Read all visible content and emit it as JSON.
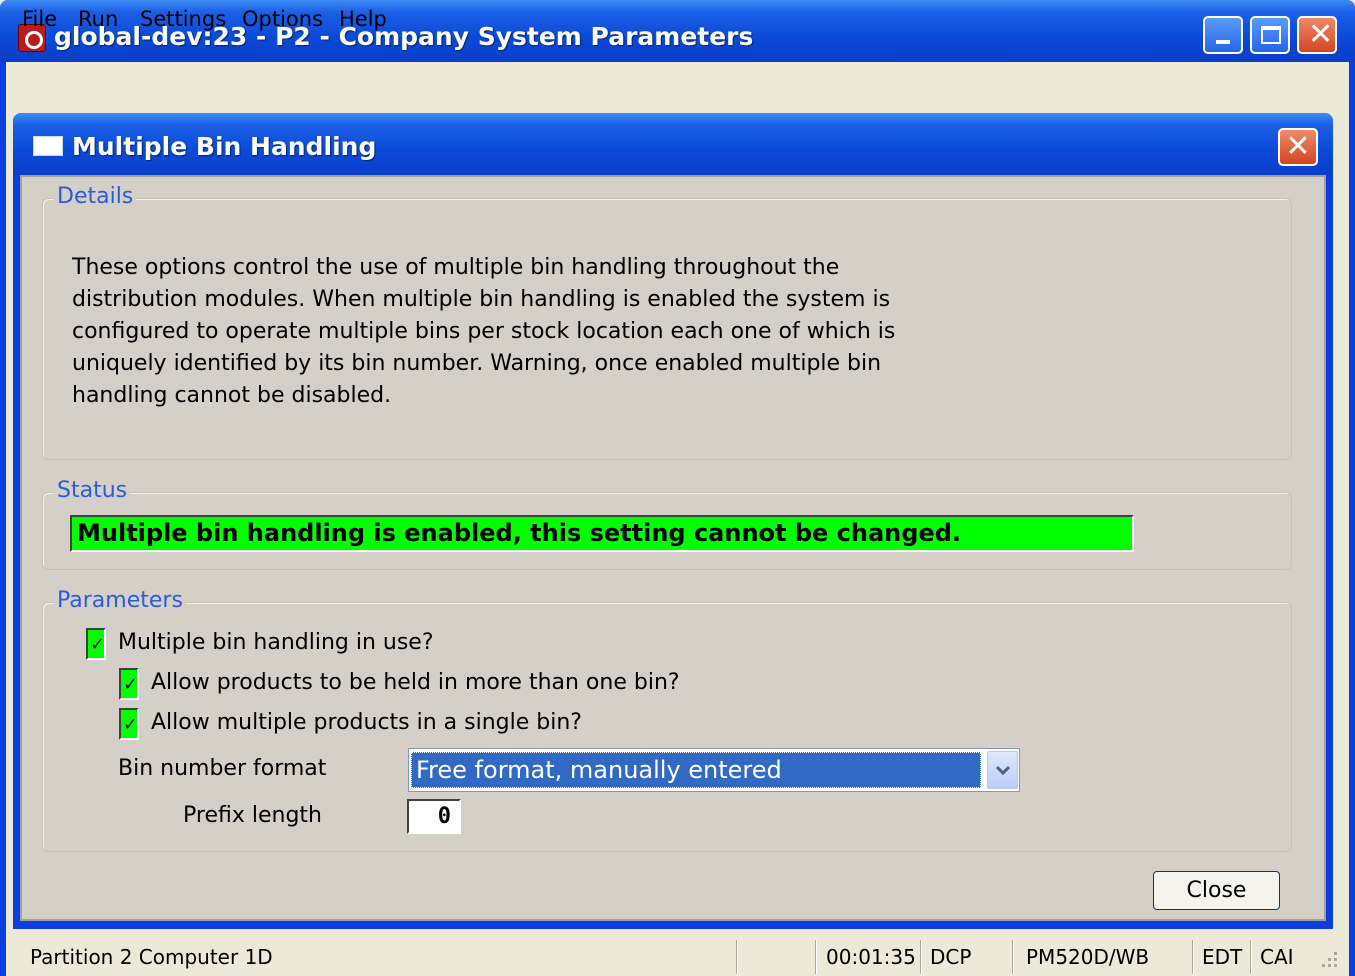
{
  "window": {
    "title": "global-dev:23 - P2 - Company System Parameters"
  },
  "menubar": {
    "items": [
      "File",
      "Run",
      "Settings",
      "Options",
      "Help"
    ]
  },
  "dialog": {
    "title": "Multiple Bin Handling",
    "details": {
      "label": "Details",
      "lines": [
        "These options control the use of multiple bin handling throughout the",
        "distribution modules.  When multiple bin handling is enabled the system is",
        "configured to operate multiple bins per stock location each one of which is",
        "uniquely identified by its bin number.  Warning, once enabled multiple bin",
        "handling cannot be disabled."
      ]
    },
    "status": {
      "label": "Status",
      "message": "Multiple bin handling is enabled, this setting cannot be changed.",
      "color": "#00ff00"
    },
    "parameters": {
      "label": "Parameters",
      "checkboxes": [
        {
          "label": "Multiple bin handling in use?",
          "checked": true
        },
        {
          "label": "Allow products to be held in more than one bin?",
          "checked": true
        },
        {
          "label": "Allow multiple products in a single bin?",
          "checked": true
        }
      ],
      "bin_format_label": "Bin number format",
      "bin_format_value": "Free format, manually entered",
      "prefix_label": "Prefix length",
      "prefix_value": "0"
    },
    "close_label": "Close"
  },
  "statusbar": {
    "location": "Partition 2 Computer 1D",
    "time": "00:01:35",
    "code1": "DCP",
    "program": "PM520D/WB",
    "mode1": "EDT",
    "mode2": "CAI"
  }
}
